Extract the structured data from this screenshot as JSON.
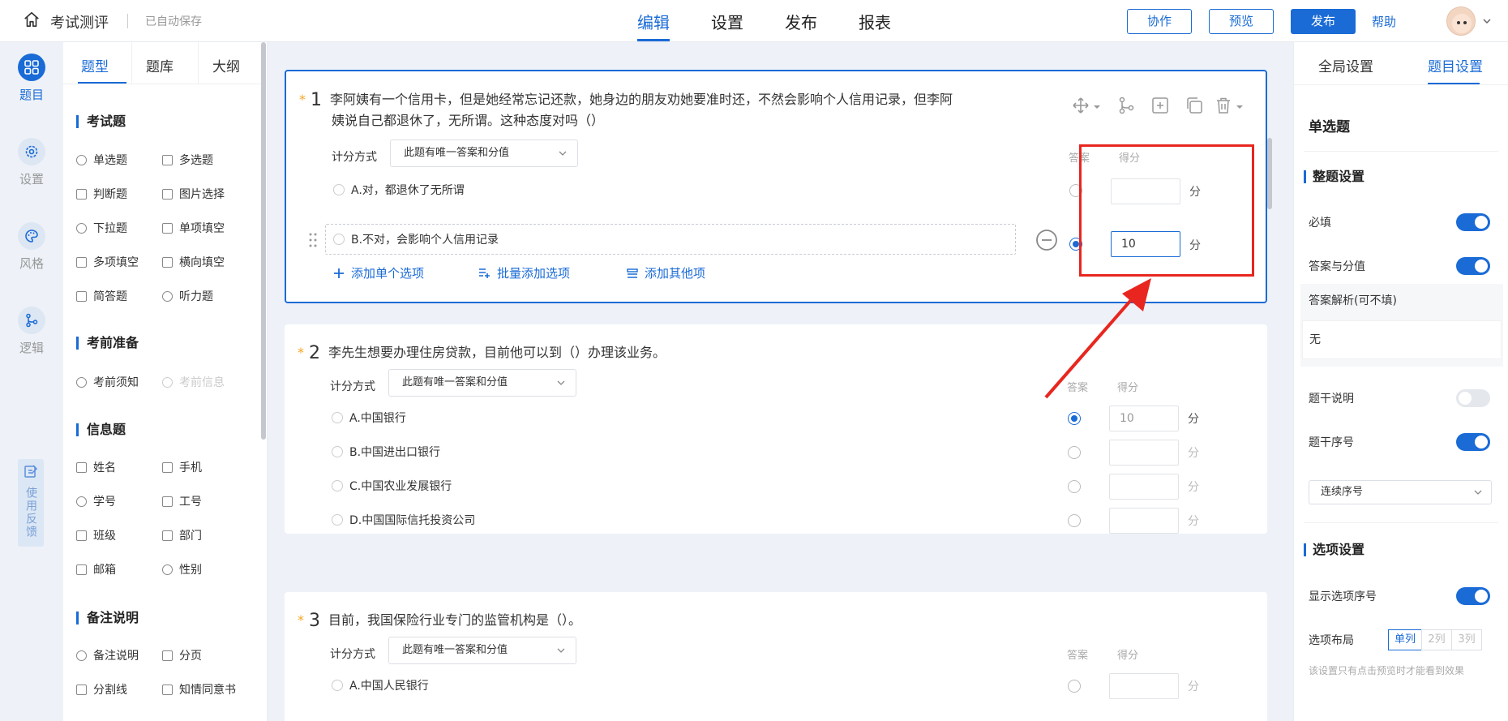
{
  "topbar": {
    "title": "考试测评",
    "autosave": "已自动保存",
    "tabs": [
      "编辑",
      "设置",
      "发布",
      "报表"
    ],
    "active_tab": "编辑",
    "btn_collab": "协作",
    "btn_preview": "预览",
    "btn_publish": "发布",
    "help": "帮助"
  },
  "leftnav": {
    "items": [
      "题目",
      "设置",
      "风格",
      "逻辑"
    ],
    "feedback": "使用反馈"
  },
  "qpanel": {
    "tabs": [
      "题型",
      "题库",
      "大纲"
    ],
    "sections": [
      {
        "title": "考试题",
        "items": [
          "单选题",
          "多选题",
          "判断题",
          "图片选择",
          "下拉题",
          "单项填空",
          "多项填空",
          "横向填空",
          "简答题",
          "听力题"
        ]
      },
      {
        "title": "考前准备",
        "items": [
          "考前须知",
          "考前信息"
        ]
      },
      {
        "title": "信息题",
        "items": [
          "姓名",
          "手机",
          "学号",
          "工号",
          "班级",
          "部门",
          "邮箱",
          "性别"
        ]
      },
      {
        "title": "备注说明",
        "items": [
          "备注说明",
          "分页",
          "分割线",
          "知情同意书"
        ]
      }
    ]
  },
  "questions": [
    {
      "num": "1",
      "text_line1": "李阿姨有一个信用卡，但是她经常忘记还款，她身边的朋友劝她要准时还，不然会影响个人信用记录，但李阿",
      "text_line2": "姨说自己都退休了，无所谓。这种态度对吗（）",
      "score_mode_label": "计分方式",
      "score_mode": "此题有唯一答案和分值",
      "col_answer": "答案",
      "col_score": "得分",
      "options": [
        {
          "label": "A.对，都退休了无所谓",
          "answer": false,
          "score": ""
        },
        {
          "label": "B.不对，会影响个人信用记录",
          "answer": true,
          "score": "10"
        }
      ],
      "unit": "分",
      "add_single": "添加单个选项",
      "add_batch": "批量添加选项",
      "add_other": "添加其他项"
    },
    {
      "num": "2",
      "text": "李先生想要办理住房贷款，目前他可以到（）办理该业务。",
      "score_mode_label": "计分方式",
      "score_mode": "此题有唯一答案和分值",
      "col_answer": "答案",
      "col_score": "得分",
      "options": [
        {
          "label": "A.中国银行",
          "answer": true,
          "score": "10"
        },
        {
          "label": "B.中国进出口银行",
          "answer": false,
          "score": ""
        },
        {
          "label": "C.中国农业发展银行",
          "answer": false,
          "score": ""
        },
        {
          "label": "D.中国国际信托投资公司",
          "answer": false,
          "score": ""
        }
      ],
      "unit": "分"
    },
    {
      "num": "3",
      "text": "目前，我国保险行业专门的监管机构是（）。",
      "score_mode_label": "计分方式",
      "score_mode": "此题有唯一答案和分值",
      "col_answer": "答案",
      "col_score": "得分",
      "options": [
        {
          "label": "A.中国人民银行",
          "answer": false,
          "score": ""
        }
      ],
      "unit": "分"
    }
  ],
  "rpanel": {
    "tabs": [
      "全局设置",
      "题目设置"
    ],
    "active_tab": "题目设置",
    "type": "单选题",
    "sec_whole": "整题设置",
    "required": "必填",
    "answer_score": "答案与分值",
    "analysis_label": "答案解析(可不填)",
    "analysis_value": "无",
    "stem_desc": "题干说明",
    "stem_number": "题干序号",
    "number_mode": "连续序号",
    "sec_options": "选项设置",
    "show_option_num": "显示选项序号",
    "layout_label": "选项布局",
    "layout_options": [
      "单列",
      "2列",
      "3列"
    ],
    "layout_active": "单列",
    "hint": "该设置只有点击预览时才能看到效果"
  },
  "colors": {
    "accent": "#1a6bd6",
    "annotation": "#e8261f",
    "star": "#f5a623"
  }
}
